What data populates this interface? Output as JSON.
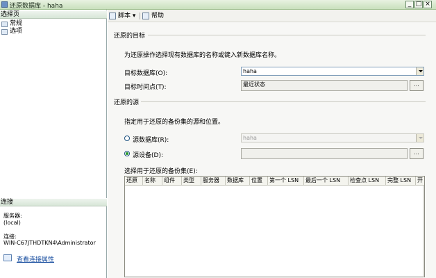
{
  "window": {
    "title": "还原数据库 - haha",
    "buttons": {
      "min": "_",
      "max": "□",
      "close": "×"
    }
  },
  "left": {
    "select_page_header": "选择页",
    "pages": [
      "常规",
      "选项"
    ],
    "connection_header": "连接",
    "server_label": "服务器:",
    "server_value": "(local)",
    "connection_label": "连接:",
    "connection_value": "WIN-C67JTHDTKN4\\Administrator",
    "view_connection_link": "查看连接属性"
  },
  "toolbar": {
    "script": "脚本",
    "script_arrow": "▾",
    "help": "帮助"
  },
  "restore_target": {
    "section_title": "还原的目标",
    "instructions": "为还原操作选择现有数据库的名称或键入新数据库名称。",
    "target_db_label": "目标数据库(O):",
    "target_db_value": "haha",
    "target_time_label": "目标时间点(T):",
    "target_time_value": "最近状态",
    "ellipsis": "..."
  },
  "restore_source": {
    "section_title": "还原的源",
    "instructions": "指定用于还原的备份集的源和位置。",
    "source_db_label": "源数据库(R):",
    "source_db_value": "haha",
    "source_device_label": "源设备(D):",
    "source_device_value": "",
    "source_device_selected": true,
    "ellipsis": "...",
    "backup_sets_label": "选择用于还原的备份集(E):"
  },
  "grid_columns": [
    "还原",
    "名称",
    "组件",
    "类型",
    "服务器",
    "数据库",
    "位置",
    "第一个 LSN",
    "最后一个 LSN",
    "检查点 LSN",
    "完整 LSN",
    "开"
  ]
}
